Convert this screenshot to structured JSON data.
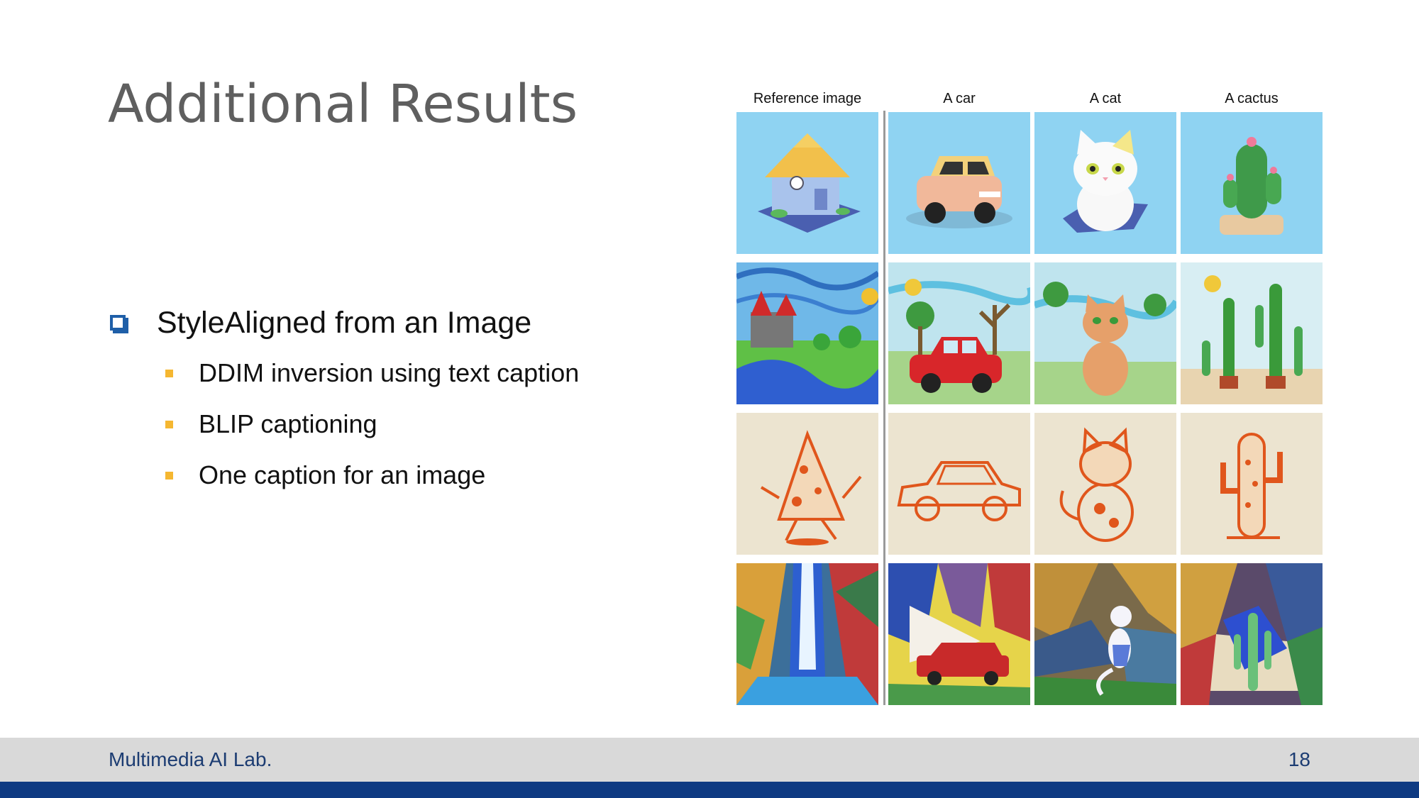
{
  "slide": {
    "title": "Additional Results",
    "bullet_main": "StyleAligned from an Image",
    "sub_bullets": [
      "DDIM inversion using text caption",
      "BLIP captioning",
      "One caption for an image"
    ]
  },
  "figure": {
    "column_headers": [
      "Reference image",
      "A car",
      "A cat",
      "A cactus"
    ]
  },
  "footer": {
    "lab_name": "Multimedia AI Lab.",
    "page_number": "18"
  }
}
